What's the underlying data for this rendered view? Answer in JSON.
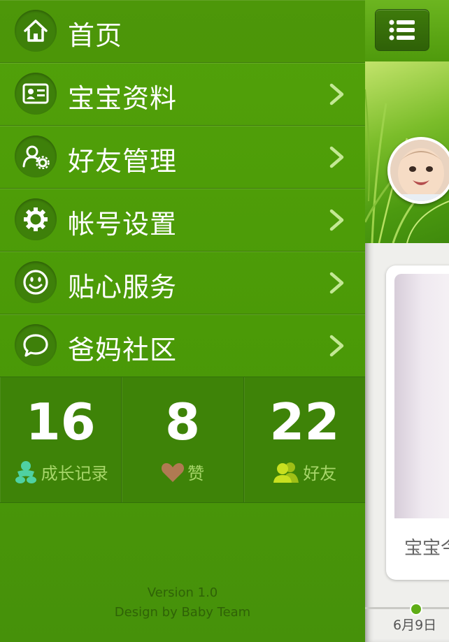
{
  "menu": {
    "items": [
      {
        "label": "首页",
        "icon": "home-icon",
        "has_arrow": false
      },
      {
        "label": "宝宝资料",
        "icon": "id-card-icon",
        "has_arrow": true
      },
      {
        "label": "好友管理",
        "icon": "friend-settings-icon",
        "has_arrow": true
      },
      {
        "label": "帐号设置",
        "icon": "gear-icon",
        "has_arrow": true
      },
      {
        "label": "贴心服务",
        "icon": "smiley-icon",
        "has_arrow": true
      },
      {
        "label": "爸妈社区",
        "icon": "chat-bubble-icon",
        "has_arrow": true
      }
    ]
  },
  "stats": [
    {
      "value": "16",
      "caption": "成长记录",
      "icon": "baby-icon",
      "color": "#4fd1a2"
    },
    {
      "value": "8",
      "caption": "赞",
      "icon": "heart-icon",
      "color": "#b07a52"
    },
    {
      "value": "22",
      "caption": "好友",
      "icon": "friends-icon",
      "color": "#c8e020"
    }
  ],
  "footer": {
    "version": "Version 1.0",
    "credit": "Design by Baby Team"
  },
  "main": {
    "card_caption": "宝宝今",
    "timeline_date": "6月9日"
  },
  "colors": {
    "drawer": "#4b9a07",
    "stats_bg": "#3e8308",
    "accent": "#5fad16"
  }
}
